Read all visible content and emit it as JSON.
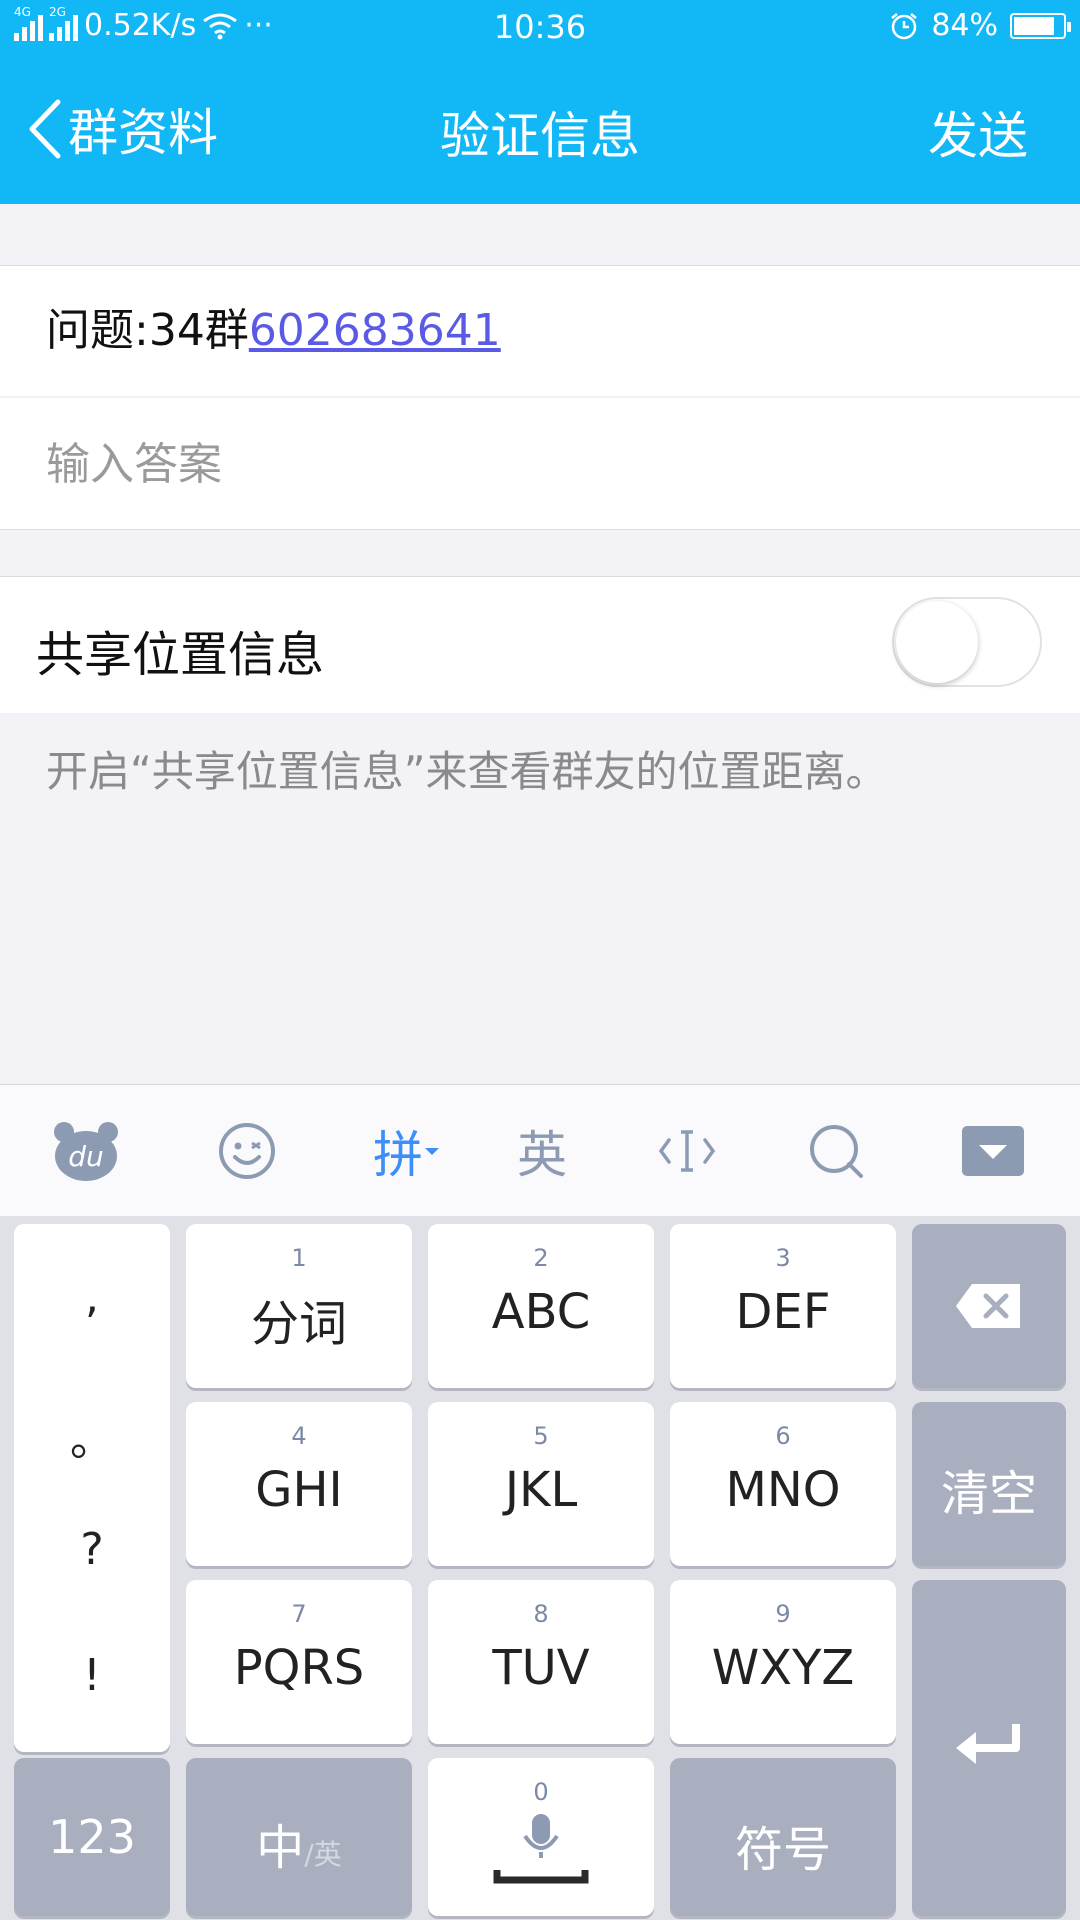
{
  "status_bar": {
    "net1": "4G",
    "net2": "2G",
    "speed": "0.52K/s",
    "dots": "···",
    "time": "10:36",
    "battery_text": "84%",
    "battery_level": 0.84
  },
  "nav": {
    "back_label": "群资料",
    "title": "验证信息",
    "send_label": "发送"
  },
  "question": {
    "prefix": "问题:34群",
    "link": "602683641"
  },
  "answer": {
    "placeholder": "输入答案",
    "value": ""
  },
  "share": {
    "label": "共享位置信息",
    "enabled": false,
    "hint": "开启“共享位置信息”来查看群友的位置距离。"
  },
  "keyboard": {
    "toolbar": {
      "pinyin": "拼",
      "english": "英"
    },
    "punct": [
      ",",
      "。",
      "?",
      "!"
    ],
    "keys": [
      {
        "num": "1",
        "label": "分词"
      },
      {
        "num": "2",
        "label": "ABC"
      },
      {
        "num": "3",
        "label": "DEF"
      },
      {
        "num": "4",
        "label": "GHI"
      },
      {
        "num": "5",
        "label": "JKL"
      },
      {
        "num": "6",
        "label": "MNO"
      },
      {
        "num": "7",
        "label": "PQRS"
      },
      {
        "num": "8",
        "label": "TUV"
      },
      {
        "num": "9",
        "label": "WXYZ"
      }
    ],
    "clear_label": "清空",
    "numeric_label": "123",
    "zh_label": "中",
    "en_sub": "/英",
    "space_num": "0",
    "symbols_label": "符号"
  },
  "colors": {
    "brand": "#12b7f5",
    "link": "#5a5ae6",
    "keyboard_accent": "#3d8ef8",
    "dark_key": "#a9afbf"
  }
}
